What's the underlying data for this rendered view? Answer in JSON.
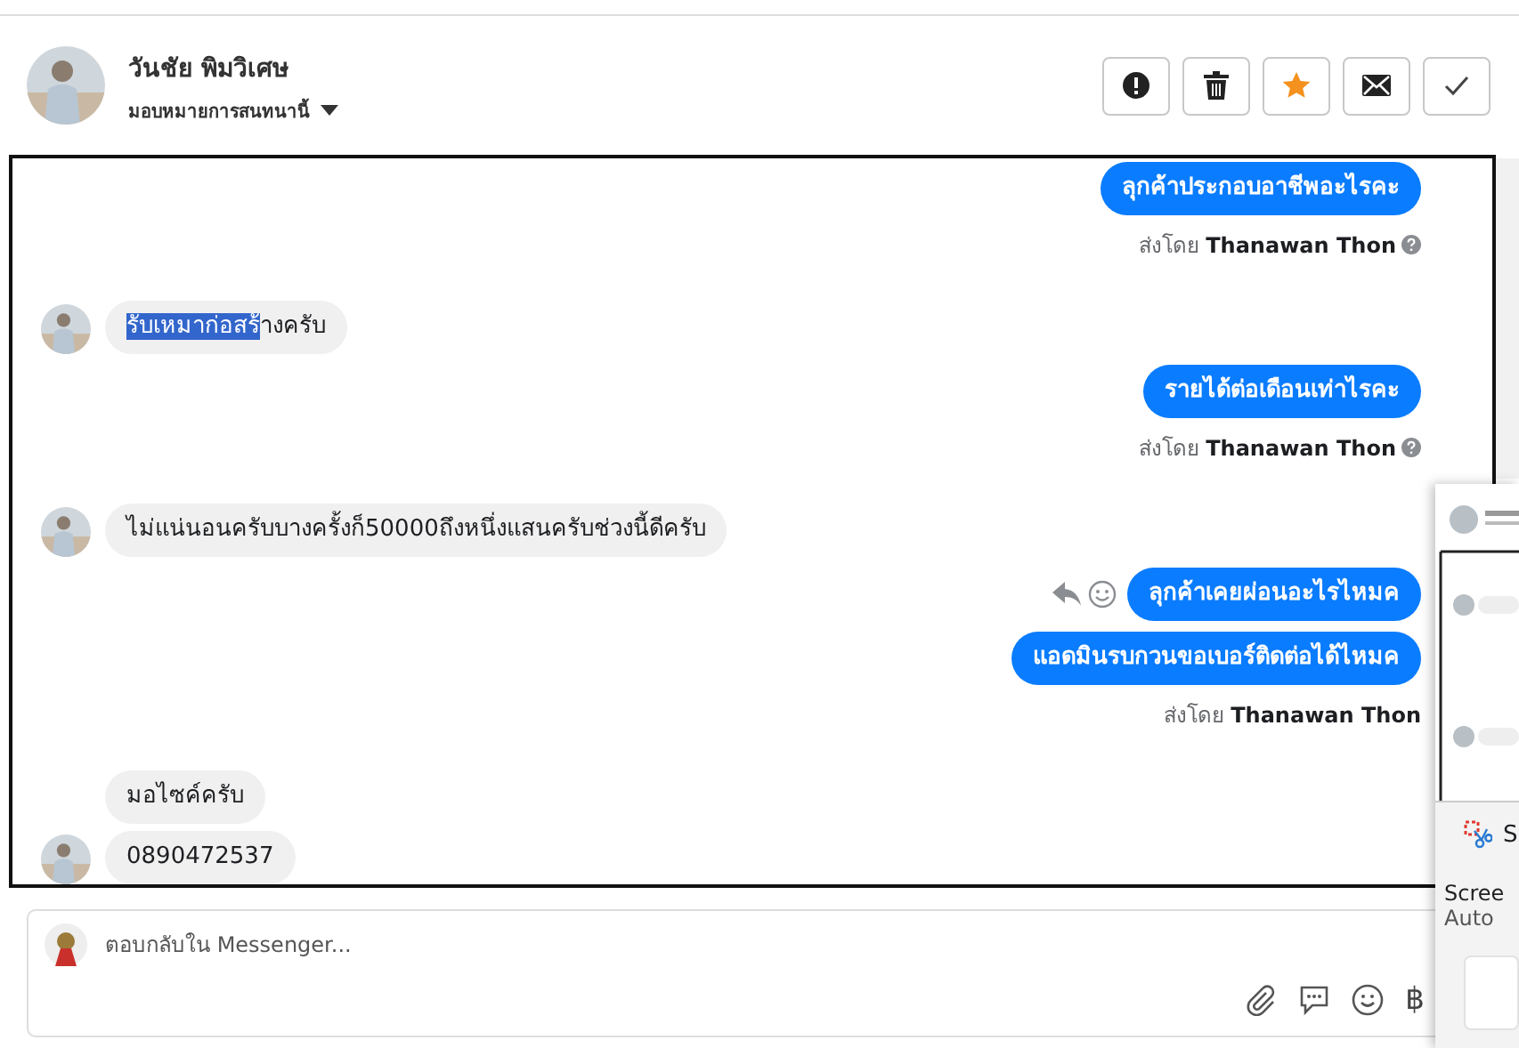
{
  "header": {
    "name": "วันชัย พิมวิเศษ",
    "assign_label": "มอบหมายการสนทนานี้",
    "actions": [
      {
        "kind": "alert",
        "on": false
      },
      {
        "kind": "trash",
        "on": false
      },
      {
        "kind": "star",
        "on": true
      },
      {
        "kind": "mail",
        "on": false
      },
      {
        "kind": "check",
        "on": false
      }
    ]
  },
  "messages": [
    {
      "kind": "sent",
      "text": "ลุกค้าประกอบอาชีพอะไรคะ",
      "hover_actions": false
    },
    {
      "kind": "sent_by",
      "prefix": "ส่งโดย",
      "sender": "Thanawan Thon",
      "info_icon": true
    },
    {
      "kind": "received",
      "highlighted": "รับเหมาก่อสร้",
      "text": "างครับ",
      "avatar": true
    },
    {
      "kind": "sent",
      "text": "รายได้ต่อเดือนเท่าไรคะ",
      "hover_actions": false
    },
    {
      "kind": "sent_by",
      "prefix": "ส่งโดย",
      "sender": "Thanawan Thon",
      "info_icon": true
    },
    {
      "kind": "received",
      "text": "ไม่แน่นอนครับบางครั้งก็50000ถึงหนึ่งแสนครับช่วงนี้ดีครับ",
      "avatar": true
    },
    {
      "kind": "sent",
      "text": "ลุกค้าเคยผ่อนอะไรไหมค",
      "hover_actions": true
    },
    {
      "kind": "sent",
      "text": "แอดมินรบกวนขอเบอร์ติดต่อได้ไหมค",
      "hover_actions": false
    },
    {
      "kind": "sent_by",
      "prefix": "ส่งโดย",
      "sender": "Thanawan Thon",
      "info_icon": false
    },
    {
      "kind": "received",
      "text": "มอไซค์ครับ",
      "avatar": false
    },
    {
      "kind": "received",
      "text": "0890472537",
      "avatar": true
    }
  ],
  "composer": {
    "placeholder": "ตอบกลับใน Messenger...",
    "currency_symbol": "฿"
  },
  "snip_overlay": {
    "app_initial": "S",
    "line_1": "Scree",
    "line_2": "Auto"
  }
}
